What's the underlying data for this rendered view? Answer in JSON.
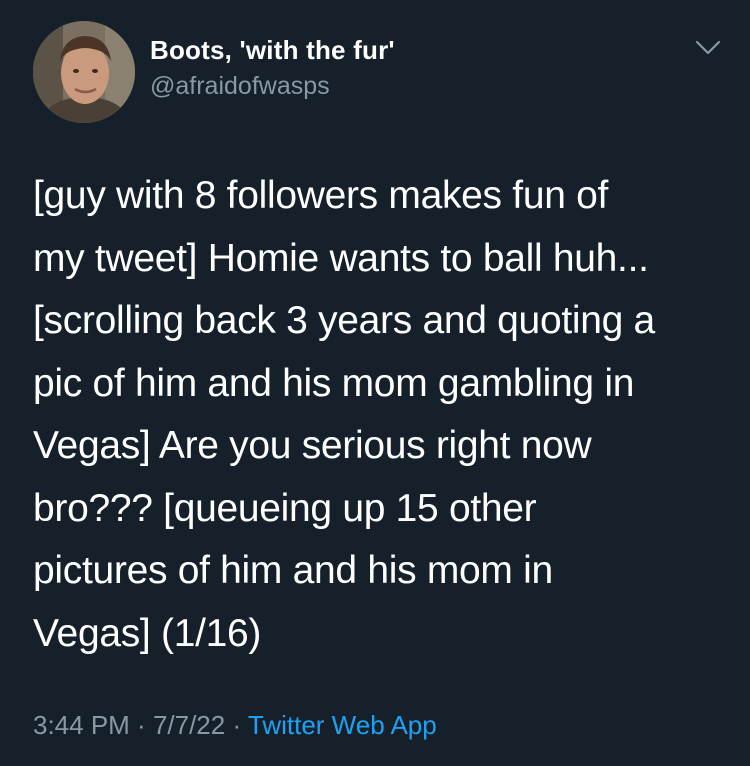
{
  "user": {
    "display_name": "Boots, 'with the fur'",
    "handle": "@afraidofwasps"
  },
  "tweet": {
    "lines": [
      "[guy with 8 followers makes fun of",
      "my tweet] Homie wants to ball huh...",
      "[scrolling back 3 years and quoting a",
      "pic of him and his mom gambling in",
      "Vegas] Are you serious right now",
      "bro??? [queueing up 15 other",
      "pictures of him and his mom in",
      "Vegas] (1/16)"
    ],
    "time": "3:44 PM",
    "sep1": " · ",
    "date": "7/7/22",
    "sep2": " · ",
    "source": "Twitter Web App"
  },
  "icons": {
    "menu": "chevron-down-icon"
  },
  "colors": {
    "background": "#15202b",
    "text": "#ffffff",
    "secondary": "#8899a6",
    "link": "#1da1f2"
  }
}
